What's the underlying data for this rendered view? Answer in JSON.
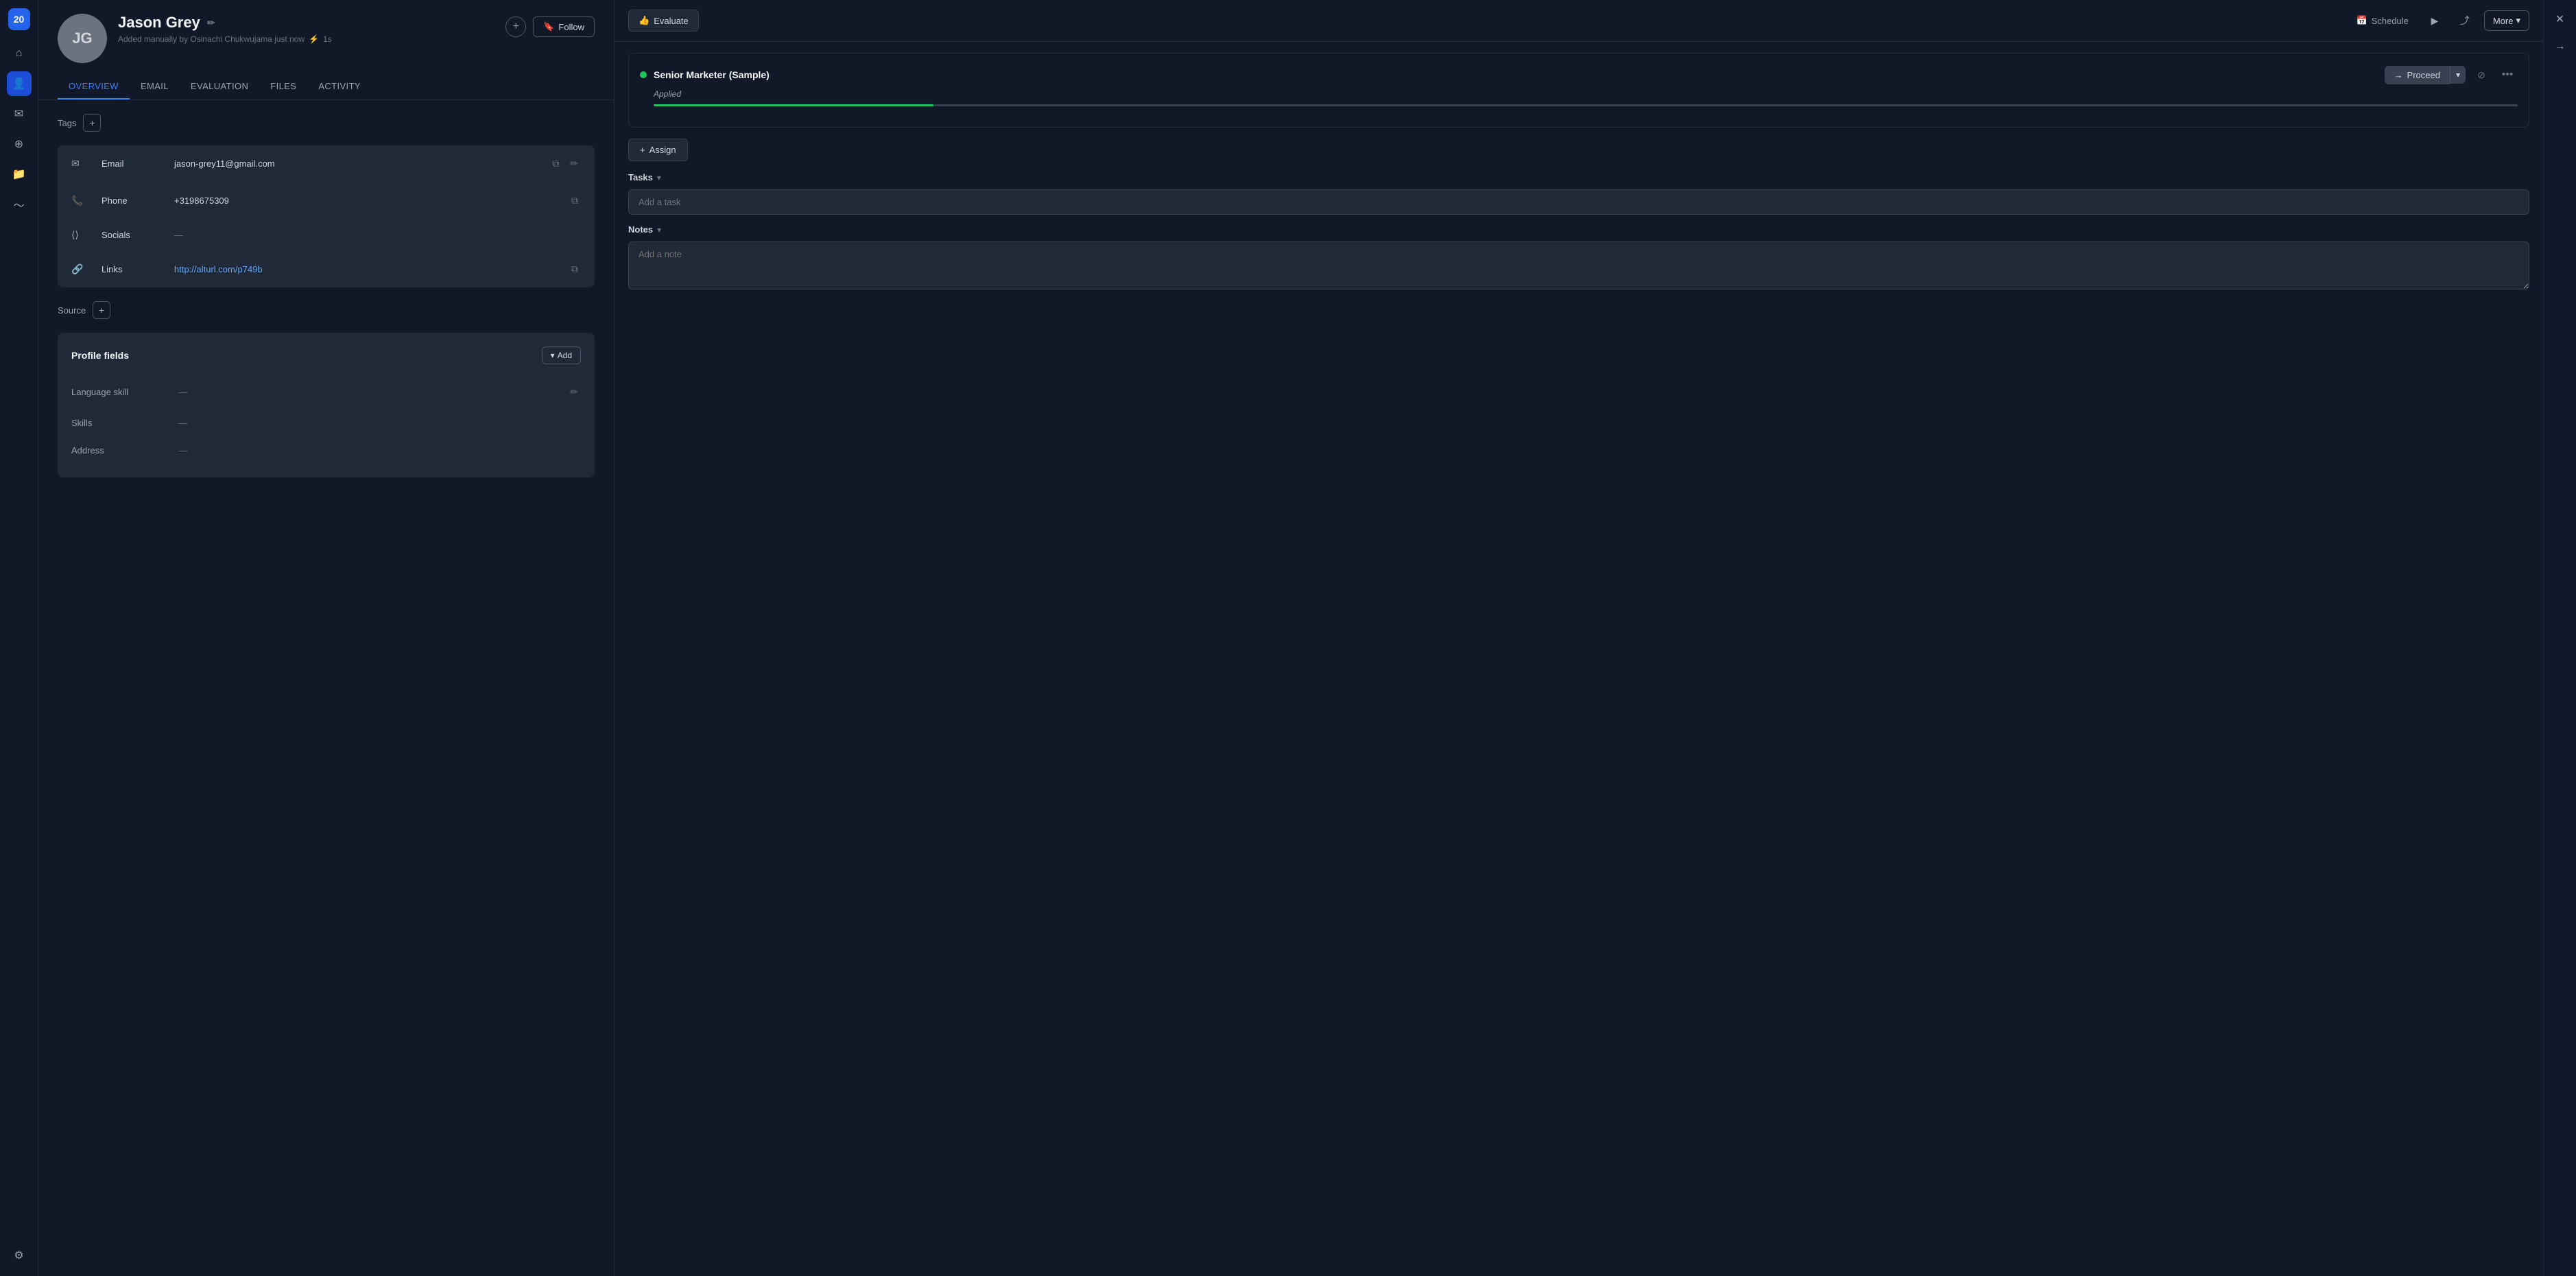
{
  "app": {
    "logo": "20",
    "logo_bg": "#2563eb"
  },
  "sidebar": {
    "items": [
      {
        "id": "home",
        "icon": "⌂",
        "active": false
      },
      {
        "id": "people",
        "icon": "👤",
        "active": true
      },
      {
        "id": "inbox",
        "icon": "✉",
        "active": false
      },
      {
        "id": "add",
        "icon": "⊕",
        "active": false
      },
      {
        "id": "folder",
        "icon": "📁",
        "active": false
      },
      {
        "id": "activity",
        "icon": "~",
        "active": false
      },
      {
        "id": "settings",
        "icon": "⚙",
        "active": false
      }
    ]
  },
  "profile": {
    "initials": "JG",
    "name": "Jason Grey",
    "meta": "Added manually by Osinachi Chukwujama just now",
    "activity": "1s",
    "add_btn": "+",
    "follow_btn": "Follow",
    "follow_icon": "🔖",
    "tabs": [
      {
        "id": "overview",
        "label": "OVERVIEW",
        "active": true
      },
      {
        "id": "email",
        "label": "EMAIL",
        "active": false
      },
      {
        "id": "evaluation",
        "label": "EVALUATION",
        "active": false
      },
      {
        "id": "files",
        "label": "FILES",
        "active": false
      },
      {
        "id": "activity",
        "label": "ACTIVITY",
        "active": false
      }
    ],
    "tags_label": "Tags",
    "contact": {
      "email": {
        "label": "Email",
        "value": "jason-grey11@gmail.com",
        "icon": "✉"
      },
      "phone": {
        "label": "Phone",
        "value": "+3198675309",
        "icon": "📞"
      },
      "socials": {
        "label": "Socials",
        "value": "—",
        "icon": "⟨⟩"
      },
      "links": {
        "label": "Links",
        "value": "http://alturl.com/p749b",
        "icon": "🔗"
      }
    },
    "source_label": "Source",
    "profile_fields": {
      "title": "Profile fields",
      "add_btn": "Add",
      "fields": [
        {
          "label": "Language skill",
          "value": "—"
        },
        {
          "label": "Skills",
          "value": "—"
        },
        {
          "label": "Address",
          "value": "—"
        }
      ]
    }
  },
  "right_panel": {
    "evaluate_btn": "Evaluate",
    "evaluate_icon": "👍",
    "schedule_btn": "Schedule",
    "schedule_icon": "📅",
    "forward_icon": "▶",
    "share_icon": "⤴",
    "more_btn": "More",
    "close_icon": "✕",
    "nav_right_icon": "→",
    "job": {
      "title": "Senior Marketer (Sample)",
      "stage": "Applied",
      "status_color": "#22c55e",
      "progress": 15,
      "proceed_btn": "Proceed",
      "proceed_icon": "→"
    },
    "assign_btn": "Assign",
    "assign_icon": "+",
    "tasks": {
      "title": "Tasks",
      "placeholder": "Add a task"
    },
    "notes": {
      "title": "Notes",
      "placeholder": "Add a note"
    }
  }
}
